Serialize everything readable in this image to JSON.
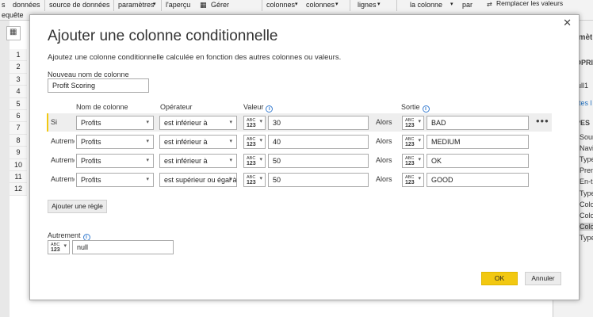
{
  "ribbon": {
    "items": [
      "s",
      "données",
      "source de données",
      "paramètres",
      "l'aperçu",
      "Gérer",
      "colonnes",
      "colonnes",
      "lignes",
      "la colonne",
      "par",
      "Remplacer les valeurs"
    ],
    "subline": "equête"
  },
  "grid": {
    "row_numbers": [
      "1",
      "2",
      "3",
      "4",
      "5",
      "6",
      "7",
      "8",
      "9",
      "10",
      "11",
      "12"
    ]
  },
  "right_pane": {
    "heading1": "amèt",
    "heading2": "OPRI",
    "name_value": "ull1",
    "link": "ites le",
    "heading3": "PES",
    "steps": [
      "Sour",
      "Navi",
      "Type",
      "Prem",
      "En-t",
      "Type",
      "Colo",
      "Colo",
      "Colo",
      "Type"
    ]
  },
  "dialog": {
    "title": "Ajouter une colonne conditionnelle",
    "description": "Ajoutez une colonne conditionnelle calculée en fonction des autres colonnes ou valeurs.",
    "new_col_label": "Nouveau nom de colonne",
    "new_col_value": "Profit Scoring",
    "headers": {
      "column": "Nom de colonne",
      "operator": "Opérateur",
      "value": "Valeur",
      "output": "Sortie"
    },
    "type_abc": "ABC",
    "type_123": "123",
    "alors_label": "Alors",
    "rules": [
      {
        "condition": "Si",
        "column": "Profits",
        "operator": "est inférieur à",
        "value": "30",
        "output": "BAD"
      },
      {
        "condition": "Autrement si",
        "column": "Profits",
        "operator": "est inférieur à",
        "value": "40",
        "output": "MEDIUM"
      },
      {
        "condition": "Autrement si",
        "column": "Profits",
        "operator": "est inférieur à",
        "value": "50",
        "output": "OK"
      },
      {
        "condition": "Autrement si",
        "column": "Profits",
        "operator": "est supérieur ou égal à",
        "value": "50",
        "output": "GOOD"
      }
    ],
    "add_rule_label": "Ajouter une règle",
    "otherwise_label": "Autrement",
    "otherwise_value": "null",
    "ok_label": "OK",
    "cancel_label": "Annuler"
  },
  "colors": {
    "accent": "#f2c811",
    "info": "#3b7fd1",
    "row_highlight": "#eeeeee"
  }
}
